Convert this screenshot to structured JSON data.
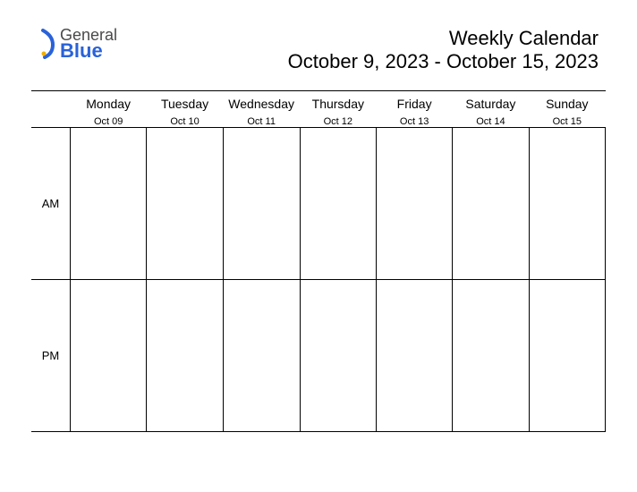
{
  "logo": {
    "line1": "General",
    "line2": "Blue"
  },
  "title": {
    "line1": "Weekly Calendar",
    "line2": "October 9, 2023 - October 15, 2023"
  },
  "days": [
    {
      "name": "Monday",
      "date": "Oct 09"
    },
    {
      "name": "Tuesday",
      "date": "Oct 10"
    },
    {
      "name": "Wednesday",
      "date": "Oct 11"
    },
    {
      "name": "Thursday",
      "date": "Oct 12"
    },
    {
      "name": "Friday",
      "date": "Oct 13"
    },
    {
      "name": "Saturday",
      "date": "Oct 14"
    },
    {
      "name": "Sunday",
      "date": "Oct 15"
    }
  ],
  "periods": {
    "am": "AM",
    "pm": "PM"
  }
}
